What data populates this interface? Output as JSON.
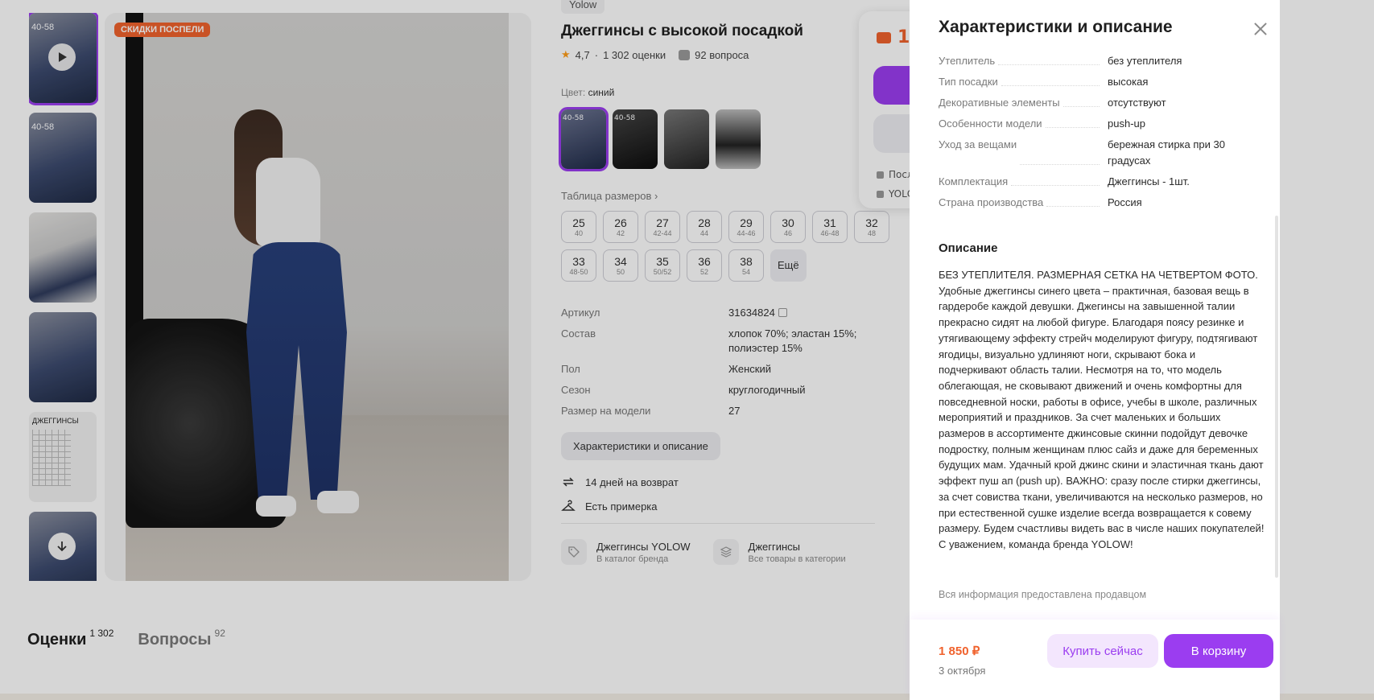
{
  "product": {
    "brand": "Yolow",
    "title": "Джеггинсы с высокой посадкой",
    "rating": "4,7",
    "reviews_count": "1 302 оценки",
    "questions_count": "92 вопроса",
    "promo_badge": "СКИДКИ ПОСПЕЛИ",
    "color_label": "Цвет:",
    "color_value": "синий",
    "thumb_label": "40-58"
  },
  "sizes": {
    "title": "Таблица размеров",
    "items": [
      {
        "size": "25",
        "ru": "40"
      },
      {
        "size": "26",
        "ru": "42"
      },
      {
        "size": "27",
        "ru": "42-44"
      },
      {
        "size": "28",
        "ru": "44"
      },
      {
        "size": "29",
        "ru": "44-46"
      },
      {
        "size": "30",
        "ru": "46"
      },
      {
        "size": "31",
        "ru": "46-48"
      },
      {
        "size": "32",
        "ru": "48"
      },
      {
        "size": "33",
        "ru": "48-50"
      },
      {
        "size": "34",
        "ru": "50"
      },
      {
        "size": "35",
        "ru": "50/52"
      },
      {
        "size": "36",
        "ru": "52"
      },
      {
        "size": "38",
        "ru": "54"
      }
    ],
    "more": "Ещё"
  },
  "params": [
    {
      "k": "Артикул",
      "v": "31634824"
    },
    {
      "k": "Состав",
      "v": "хлопок 70%; эластан 15%; полиэстер 15%"
    },
    {
      "k": "Пол",
      "v": "Женский"
    },
    {
      "k": "Сезон",
      "v": "круглогодичный"
    },
    {
      "k": "Размер на модели",
      "v": "27"
    }
  ],
  "char_button": "Характеристики и описание",
  "features": {
    "return": "14 дней на возврат",
    "fitting": "Есть примерка"
  },
  "links": [
    {
      "title": "Джеггинсы YOLOW",
      "sub": "В каталог бренда"
    },
    {
      "title": "Джеггинсы",
      "sub": "Все товары в категории"
    }
  ],
  "buy_card": {
    "price_partial": "1",
    "line1": "Посл",
    "line2": "YOLC"
  },
  "tabs": [
    {
      "label": "Оценки",
      "count": "1 302"
    },
    {
      "label": "Вопросы",
      "count": "92"
    }
  ],
  "panel": {
    "title": "Характеристики и описание",
    "specs": [
      {
        "k": "Утеплитель",
        "v": "без утеплителя"
      },
      {
        "k": "Тип посадки",
        "v": "высокая"
      },
      {
        "k": "Декоративные элементы",
        "v": "отсутствуют"
      },
      {
        "k": "Особенности модели",
        "v": "push-up"
      },
      {
        "k": "Уход за вещами",
        "v": "бережная стирка при 30 градусах"
      },
      {
        "k": "Комплектация",
        "v": "Джеггинсы - 1шт."
      },
      {
        "k": "Страна производства",
        "v": "Россия"
      }
    ],
    "description_title": "Описание",
    "description": "БЕЗ УТЕПЛИТЕЛЯ. РАЗМЕРНАЯ СЕТКА НА ЧЕТВЕРТОМ ФОТО. Удобные джеггинсы синего цвета – практичная, базовая вещь в гардеробе каждой девушки. Джегинсы на завышенной талии прекрасно сидят на любой фигуре. Благодаря поясу резинке и утягивающему эффекту стрейч моделируют фигуру, подтягивают ягодицы, визуально удлиняют ноги, скрывают бока и подчеркивают область талии. Несмотря на то, что модель облегающая, не сковывают движений и очень комфортны для повседневной носки, работы в офисе, учебы в школе, различных мероприятий и праздников. За счет маленьких и больших размеров в ассортименте джинсовые скинни подойдут девочке подростку, полным женщинам плюс сайз и даже для беременных будущих мам. Удачный крой джинс скини и эластичная ткань дают эффект пуш ап (push up). ВАЖНО: сразу после стирки джеггинсы, за счет совиства ткани, увеличиваются на несколько размеров, но при естественной сушке изделие всегда возвращается к совему размеру. Будем счастливы видеть вас в числе наших покупателей! С уважением, команда бренда YOLOW!",
    "seller_note": "Вся информация предоставлена продавцом",
    "footer_price": "1 850 ₽",
    "footer_date": "3 октября",
    "buy_now": "Купить сейчас",
    "to_cart": "В корзину"
  },
  "colors": {
    "accent": "#9b3df0",
    "price": "#f0622d",
    "star": "#ff9e1a"
  }
}
